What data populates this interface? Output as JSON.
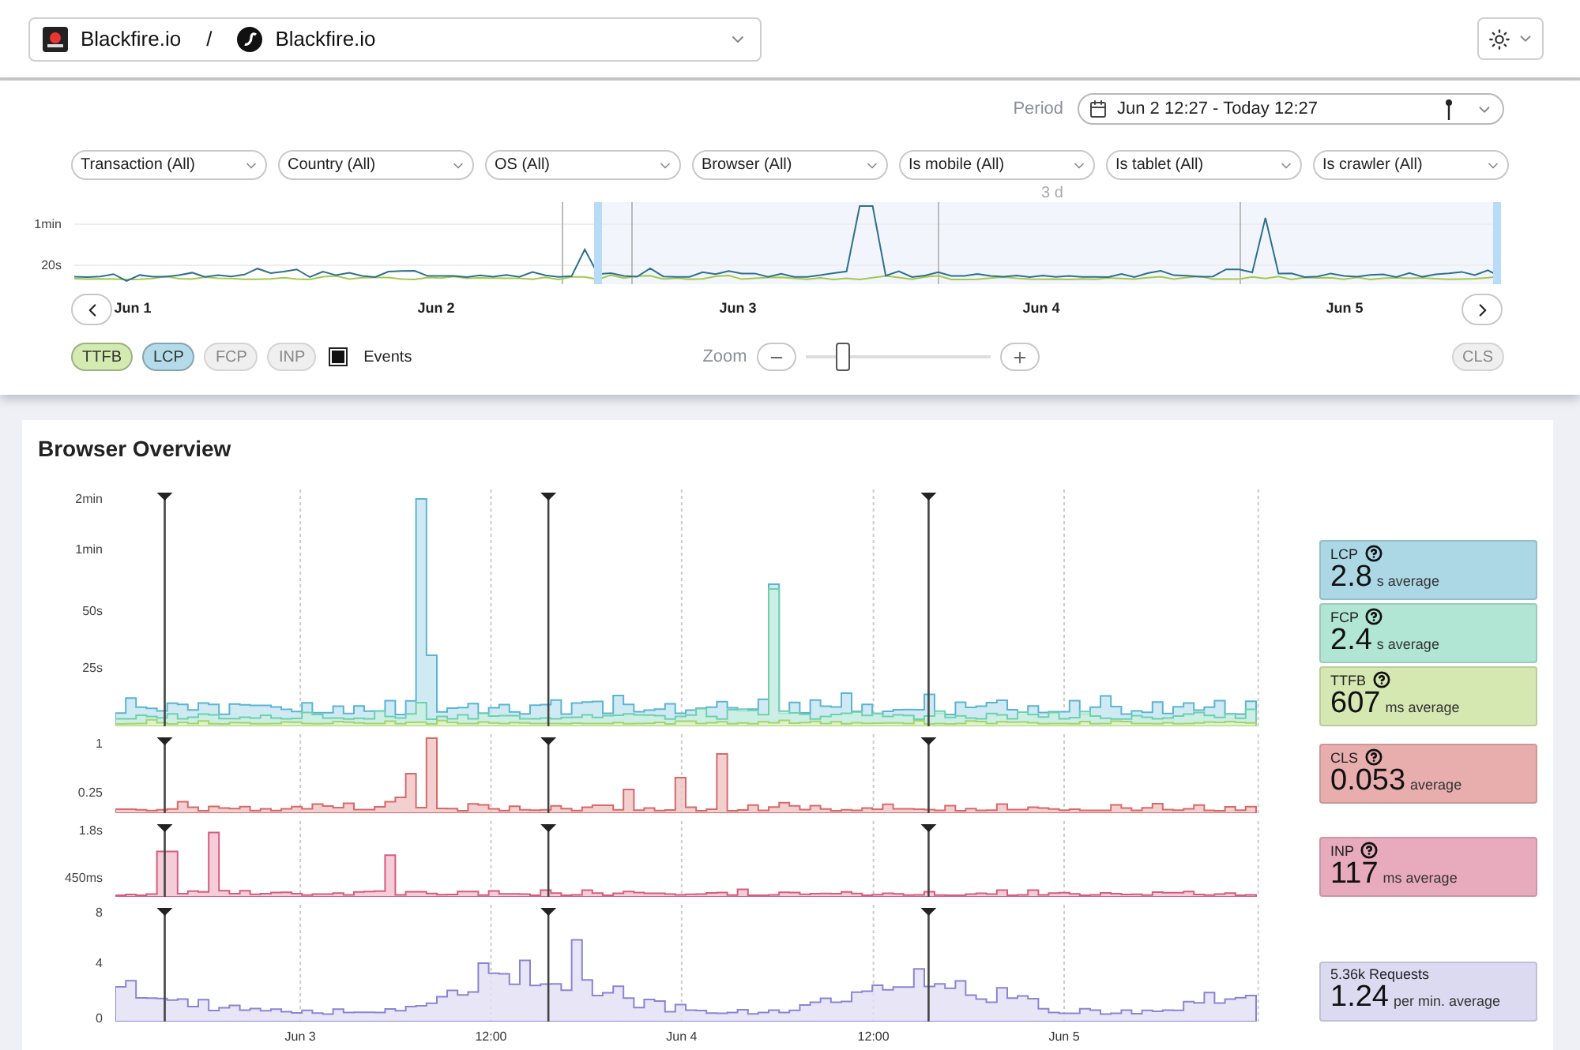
{
  "header": {
    "breadcrumb": [
      {
        "label": "Blackfire.io",
        "kind": "org"
      },
      {
        "label": "Blackfire.io",
        "kind": "app"
      }
    ],
    "separator": "/"
  },
  "filters": {
    "period": {
      "label": "Period",
      "value": "Jun 2 12:27 - Today 12:27"
    },
    "selects": [
      "Transaction (All)",
      "Country (All)",
      "OS (All)",
      "Browser (All)",
      "Is mobile (All)",
      "Is tablet (All)",
      "Is crawler (All)"
    ]
  },
  "overview": {
    "range_label": "3 d",
    "yticks": [
      "1min",
      "20s"
    ],
    "dates": [
      "Jun 1",
      "Jun 2",
      "Jun 3",
      "Jun 4",
      "Jun 5"
    ],
    "legend": [
      {
        "label": "TTFB",
        "on": true,
        "color": "#d3eab0"
      },
      {
        "label": "LCP",
        "on": true,
        "color": "#b3dbea"
      },
      {
        "label": "FCP",
        "on": false
      },
      {
        "label": "INP",
        "on": false
      }
    ],
    "events": {
      "label": "Events",
      "checked": true
    },
    "zoom": {
      "label": "Zoom",
      "level": 0.2
    },
    "cls": {
      "label": "CLS",
      "on": false
    }
  },
  "browser_overview": {
    "title": "Browser Overview",
    "panels": [
      {
        "kind": "timings",
        "yticks": [
          "2min",
          "1min",
          "50s",
          "25s"
        ],
        "cards": [
          {
            "name": "LCP",
            "help": true,
            "value": "2.8",
            "unit": "s average",
            "color": "#acd8e6"
          },
          {
            "name": "FCP",
            "help": true,
            "value": "2.4",
            "unit": "s average",
            "color": "#b1e6d4"
          },
          {
            "name": "TTFB",
            "help": true,
            "value": "607",
            "unit": "ms average",
            "color": "#d6e8b2"
          }
        ]
      },
      {
        "kind": "cls",
        "yticks": [
          "1",
          "0.25"
        ],
        "cards": [
          {
            "name": "CLS",
            "help": true,
            "value": "0.053",
            "unit": "average",
            "color": "#e8adad"
          }
        ]
      },
      {
        "kind": "inp",
        "yticks": [
          "1.8s",
          "450ms"
        ],
        "cards": [
          {
            "name": "INP",
            "help": true,
            "value": "117",
            "unit": "ms average",
            "color": "#e8abbd"
          }
        ]
      },
      {
        "kind": "requests",
        "yticks": [
          "8",
          "4",
          "0"
        ],
        "cards": [
          {
            "name": "5.36k Requests",
            "help": false,
            "value": "1.24",
            "unit": "per min. average",
            "color": "#dcdaf0"
          }
        ]
      }
    ],
    "xlabels": [
      "Jun 3",
      "12:00",
      "Jun 4",
      "12:00",
      "Jun 5"
    ]
  }
}
